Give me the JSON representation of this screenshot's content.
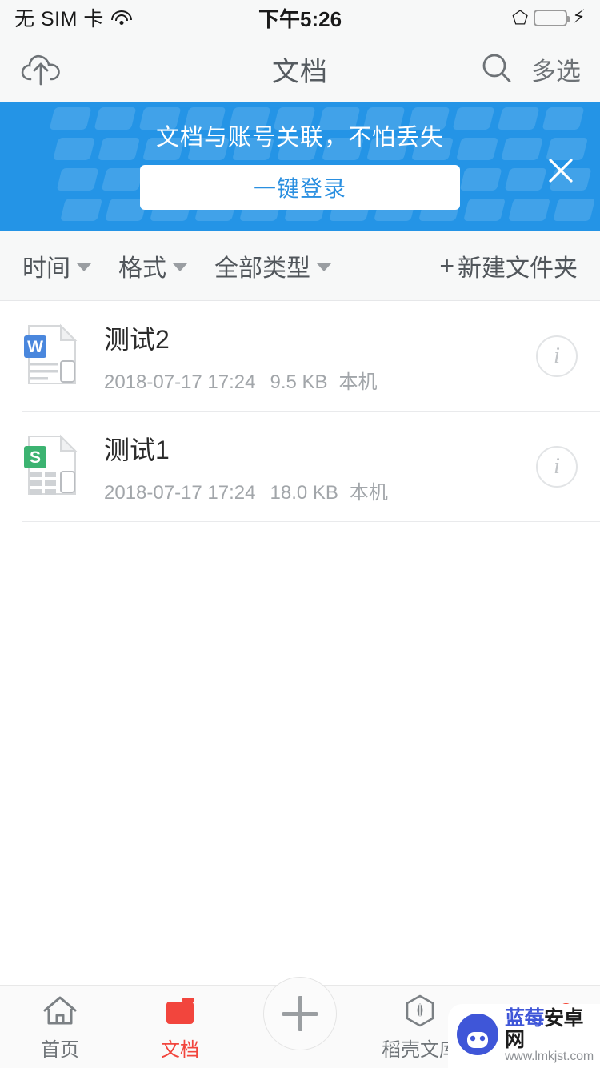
{
  "status_bar": {
    "carrier": "无 SIM 卡",
    "wifi_icon": "wifi-icon",
    "time": "下午5:26",
    "bluetooth_icon": "bluetooth-icon",
    "battery_icon": "battery-icon",
    "charging_icon": "charging-bolt-icon",
    "battery_color": "#4cd964"
  },
  "nav_bar": {
    "upload_icon": "cloud-upload-icon",
    "title": "文档",
    "search_icon": "search-icon",
    "multi_select_label": "多选"
  },
  "banner": {
    "text": "文档与账号关联，不怕丢失",
    "button_label": "一键登录",
    "close_icon": "close-icon",
    "background_color": "#2494e6",
    "button_text_color": "#2a8fe0"
  },
  "filter_bar": {
    "filters": [
      {
        "label": "时间",
        "caret": "chevron-down-icon"
      },
      {
        "label": "格式",
        "caret": "chevron-down-icon"
      },
      {
        "label": "全部类型",
        "caret": "chevron-down-icon"
      }
    ],
    "new_folder": {
      "plus": "+",
      "label": "新建文件夹"
    }
  },
  "file_list": {
    "files": [
      {
        "name": "测试2",
        "date": "2018-07-17 17:24",
        "size": "9.5 KB",
        "location": "本机",
        "icon": "word-document-icon",
        "icon_letter": "W",
        "icon_color": "#4a87dd",
        "info_icon": "info-icon"
      },
      {
        "name": "测试1",
        "date": "2018-07-17 17:24",
        "size": "18.0 KB",
        "location": "本机",
        "icon": "spreadsheet-document-icon",
        "icon_letter": "S",
        "icon_color": "#3cb371",
        "info_icon": "info-icon"
      }
    ]
  },
  "tab_bar": {
    "active_color": "#f2453d",
    "tabs": [
      {
        "label": "首页",
        "icon": "home-icon"
      },
      {
        "label": "文档",
        "icon": "folder-icon"
      },
      {
        "label": "",
        "icon": "plus-icon"
      },
      {
        "label": "稻壳文库",
        "icon": "hexagon-leaf-icon"
      },
      {
        "label": "",
        "icon": "profile-icon"
      }
    ]
  },
  "watermark": {
    "logo_icon": "android-robot-logo",
    "brand_blue": "蓝莓",
    "brand_black": "安卓网",
    "url": "www.lmkjst.com"
  }
}
